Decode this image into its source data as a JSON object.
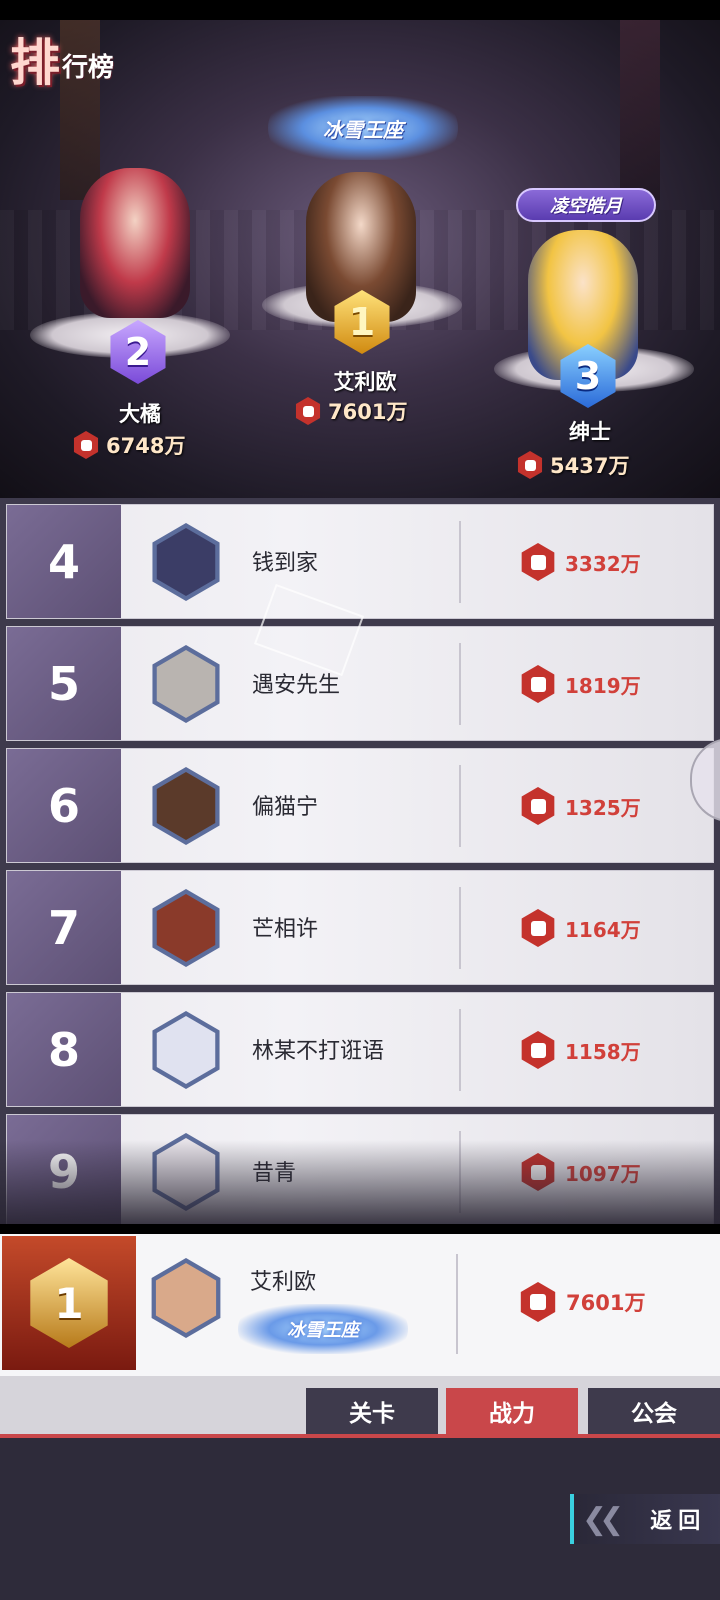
{
  "title": {
    "big": "排",
    "small": "行榜"
  },
  "podium": {
    "badges": {
      "first_title": "冰雪王座",
      "third_title": "凌空皓月"
    },
    "first": {
      "rank": "1",
      "name": "艾利欧",
      "power": "7601万"
    },
    "second": {
      "rank": "2",
      "name": "大橘",
      "power": "6748万"
    },
    "third": {
      "rank": "3",
      "name": "绅士",
      "power": "5437万"
    }
  },
  "list": [
    {
      "rank": "4",
      "name": "钱到家",
      "power": "3332万",
      "avatar_color": "#3b3d66"
    },
    {
      "rank": "5",
      "name": "遇安先生",
      "power": "1819万",
      "avatar_color": "#b9b4b0"
    },
    {
      "rank": "6",
      "name": "偏猫宁",
      "power": "1325万",
      "avatar_color": "#5b3a2a"
    },
    {
      "rank": "7",
      "name": "芒相许",
      "power": "1164万",
      "avatar_color": "#8a3a2a"
    },
    {
      "rank": "8",
      "name": "林某不打诳语",
      "power": "1158万",
      "avatar_color": "#e0e2f0"
    },
    {
      "rank": "9",
      "name": "昔青",
      "power": "1097万",
      "avatar_color": "#e8e4ea"
    }
  ],
  "self": {
    "rank": "1",
    "name": "艾利欧",
    "title": "冰雪王座",
    "power": "7601万"
  },
  "tabs": {
    "stage": "关卡",
    "power": "战力",
    "guild": "公会"
  },
  "back": "返回",
  "colors": {
    "accent": "#c9474a",
    "power_text": "#d1403a",
    "rank_cell": "#6b5e86"
  }
}
